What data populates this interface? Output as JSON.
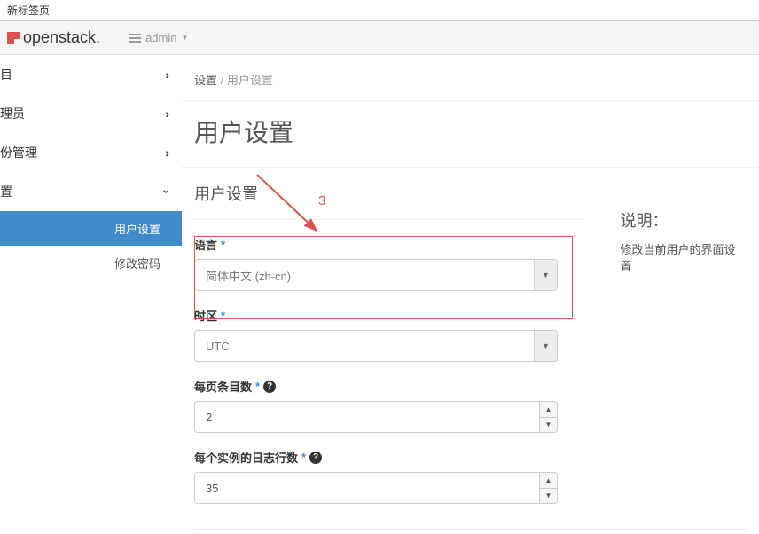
{
  "browser": {
    "tab_title": "新标签页"
  },
  "topbar": {
    "brand": "openstack.",
    "project_label": "admin"
  },
  "sidebar": {
    "items": [
      {
        "label": "目",
        "expanded": false
      },
      {
        "label": "理员",
        "expanded": false
      },
      {
        "label": "份管理",
        "expanded": false
      },
      {
        "label": "置",
        "expanded": true
      }
    ],
    "sub_items": [
      {
        "label": "用户设置",
        "active": true
      },
      {
        "label": "修改密码",
        "active": false
      }
    ]
  },
  "breadcrumb": {
    "first": "设置",
    "sep": "/",
    "current": "用户设置"
  },
  "page": {
    "title": "用户设置"
  },
  "panel": {
    "title": "用户设置"
  },
  "form": {
    "language": {
      "label": "语言",
      "value": "简体中文 (zh-cn)"
    },
    "timezone": {
      "label": "时区",
      "value": "UTC"
    },
    "page_size": {
      "label": "每页条目数",
      "value": "2"
    },
    "log_lines": {
      "label": "每个实例的日志行数",
      "value": "35"
    }
  },
  "description": {
    "title": "说明：",
    "text": "修改当前用户的界面设置"
  },
  "annotation": {
    "number": "3"
  }
}
